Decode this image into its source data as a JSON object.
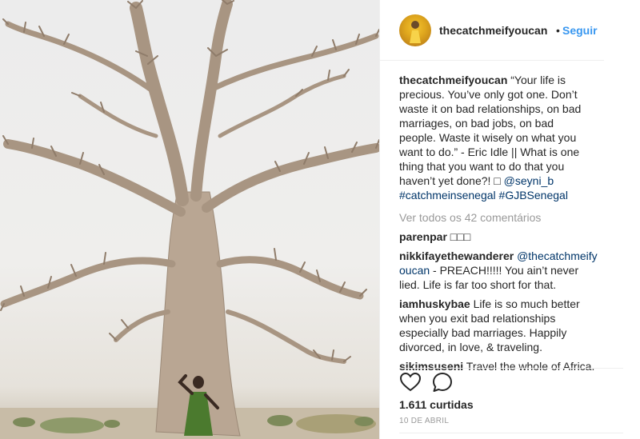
{
  "photo": {
    "alt": ""
  },
  "header": {
    "username": "thecatchmeifyoucan",
    "separator": "•",
    "follow_label": "Seguir"
  },
  "caption": {
    "username": "thecatchmeifyoucan",
    "lines": [
      "“Your life is",
      "precious. You’ve only got one. Don’t",
      "waste it on bad relationships, on bad",
      "marriages, on bad jobs, on bad",
      "people. Waste it wisely on what you",
      "want to do.” - Eric Idle || What is one",
      "thing that you want to do that you",
      "haven’t yet done?! □ "
    ],
    "mention": "@seyni_b",
    "hashtag1": "#catchmeinsenegal",
    "hashtag2": "#GJBSenegal"
  },
  "view_all": "Ver todos os 42 comentários",
  "comments": [
    {
      "username": "parenpar",
      "text": " □□□"
    },
    {
      "username": "nikkifayethewanderer",
      "mention_a": "@thecatchmeify",
      "mention_b": "oucan",
      "text_a": " - PREACH!!!!! You ain’t never",
      "text_b": "lied. Life is far too short for that."
    },
    {
      "username": "iamhuskybae",
      "text_a": " Life is so much better",
      "text_b": "when you exit bad relationships",
      "text_c": "especially bad marriages. Happily",
      "text_d": "divorced, in love, & traveling."
    },
    {
      "username": "sikimsuseni",
      "text": " Travel the whole of Africa."
    }
  ],
  "likes": "1.611 curtidas",
  "date": "10 DE ABRIL",
  "colors": {
    "link": "#3897f0",
    "hashtag": "#003569",
    "muted": "#999999",
    "text": "#262626"
  },
  "icons": {
    "like": "heart-icon",
    "comment": "comment-bubble-icon"
  }
}
